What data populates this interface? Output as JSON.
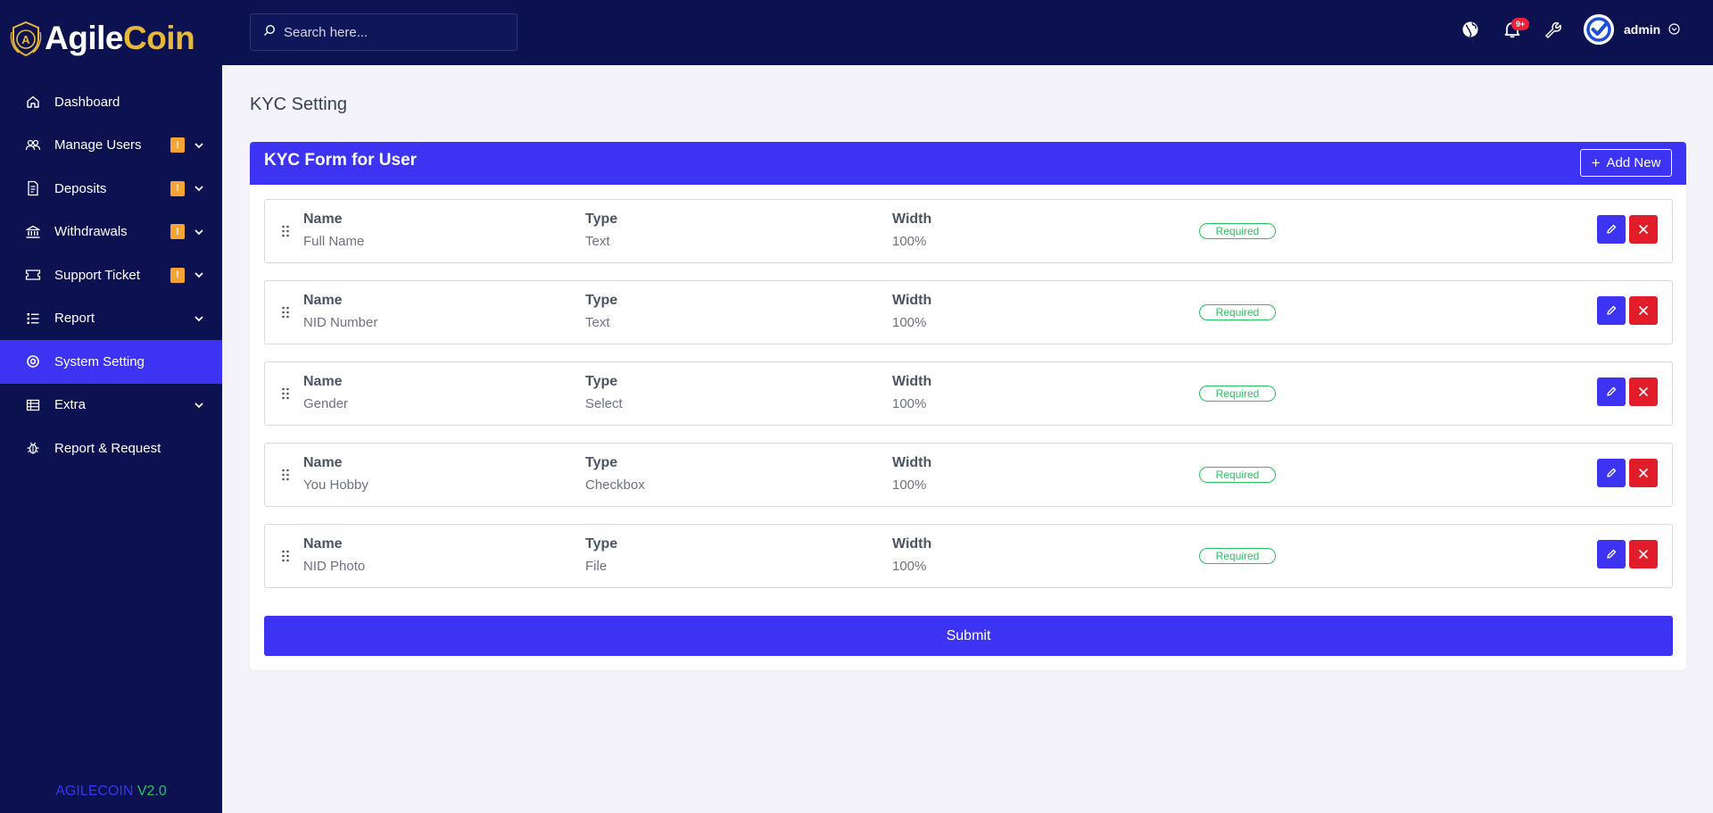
{
  "brand": {
    "part1": "Agile",
    "part2": "Coin",
    "version_name": "AGILECOIN",
    "version": "V2.0"
  },
  "search": {
    "placeholder": "Search here..."
  },
  "topbar": {
    "notification_count": "9+",
    "admin_name": "admin"
  },
  "sidebar": {
    "items": [
      {
        "label": "Dashboard",
        "icon": "home-icon"
      },
      {
        "label": "Manage Users",
        "icon": "users-icon",
        "badge": "!"
      },
      {
        "label": "Deposits",
        "icon": "deposits-icon",
        "badge": "!"
      },
      {
        "label": "Withdrawals",
        "icon": "bank-icon",
        "badge": "!"
      },
      {
        "label": "Support Ticket",
        "icon": "ticket-icon",
        "badge": "!"
      },
      {
        "label": "Report",
        "icon": "list-icon"
      },
      {
        "label": "System Setting",
        "icon": "settings-icon",
        "active": true
      },
      {
        "label": "Extra",
        "icon": "table-icon"
      },
      {
        "label": "Report & Request",
        "icon": "bug-icon"
      }
    ]
  },
  "page": {
    "title": "KYC Setting"
  },
  "card": {
    "title": "KYC Form for User",
    "add_label": "Add New",
    "col_labels": {
      "name": "Name",
      "type": "Type",
      "width": "Width"
    },
    "required_label": "Required",
    "fields": [
      {
        "name": "Full Name",
        "type": "Text",
        "width": "100%"
      },
      {
        "name": "NID Number",
        "type": "Text",
        "width": "100%"
      },
      {
        "name": "Gender",
        "type": "Select",
        "width": "100%"
      },
      {
        "name": "You Hobby",
        "type": "Checkbox",
        "width": "100%"
      },
      {
        "name": "NID Photo",
        "type": "File",
        "width": "100%"
      }
    ],
    "submit_label": "Submit"
  },
  "colors": {
    "navy": "#0c1150",
    "accent": "#3c34f2",
    "danger": "#e11d2a",
    "success": "#22c55e",
    "badge": "#f7a334",
    "gold": "#e8b83a"
  }
}
